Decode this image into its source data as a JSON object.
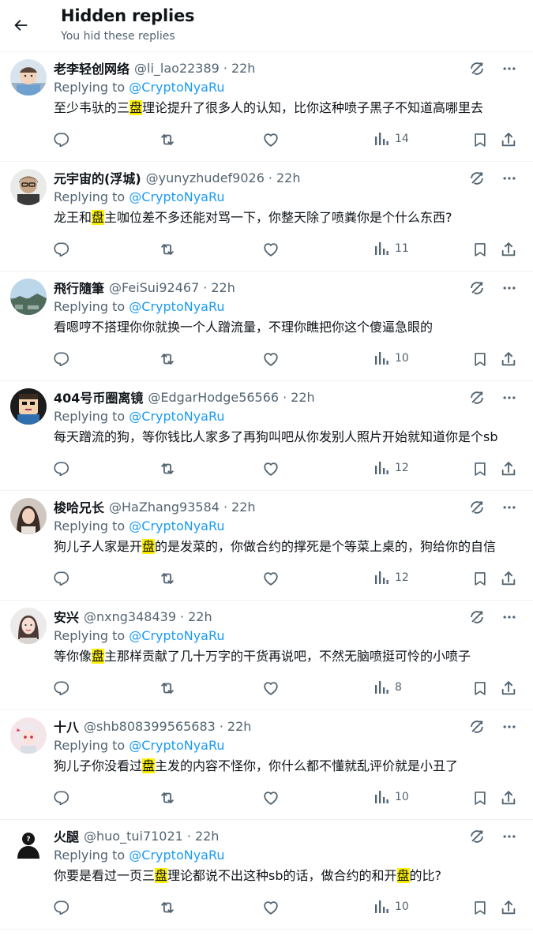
{
  "header": {
    "title": "Hidden replies",
    "subtitle": "You hid these replies"
  },
  "replying_prefix": "Replying to",
  "replies": [
    {
      "name": "老李轻创网络",
      "handle": "@li_lao22389",
      "time": "22h",
      "replying_to": "@CryptoNyaRu",
      "text_parts": [
        "至少韦驮的三",
        "盘",
        "理论提升了很多人的认知，比你这种喷子黑子不知道高哪里去"
      ],
      "views": "14",
      "avatar": "baby-photo-avatar"
    },
    {
      "name": "元宇宙的(浮城)",
      "handle": "@yunyzhudef9026",
      "time": "22h",
      "replying_to": "@CryptoNyaRu",
      "text_parts": [
        "龙王和",
        "盘",
        "主咖位差不多还能对骂一下，你整天除了喷粪你是个什么东西?"
      ],
      "views": "11",
      "avatar": "man-photo-avatar"
    },
    {
      "name": "飛行隨筆",
      "handle": "@FeiSui92467",
      "time": "22h",
      "replying_to": "@CryptoNyaRu",
      "text_parts": [
        "看嗯哼不搭理你你就换一个人蹭流量，不理你瞧把你这个傻逼急眼的",
        "",
        ""
      ],
      "views": "10",
      "avatar": "landscape-avatar"
    },
    {
      "name": "404号币圈离镜",
      "handle": "@EdgarHodge56566",
      "time": "22h",
      "replying_to": "@CryptoNyaRu",
      "text_parts": [
        "每天蹭流的狗，等你钱比人家多了再狗叫吧从你发别人照片开始就知道你是个sb",
        "",
        ""
      ],
      "views": "12",
      "avatar": "cartoon-avatar"
    },
    {
      "name": "梭哈兄长",
      "handle": "@HaZhang93584",
      "time": "22h",
      "replying_to": "@CryptoNyaRu",
      "text_parts": [
        "狗儿子人家是开",
        "盘",
        "的是发菜的，你做合约的撑死是个等菜上桌的，狗给你的自信"
      ],
      "views": "12",
      "avatar": "woman-photo-avatar"
    },
    {
      "name": "安兴",
      "handle": "@nxng348439",
      "time": "22h",
      "replying_to": "@CryptoNyaRu",
      "text_parts": [
        "等你像",
        "盘",
        "主那样贡献了几十万字的干货再说吧，不然无脑喷挺可怜的小喷子"
      ],
      "views": "8",
      "avatar": "woman-portrait-avatar"
    },
    {
      "name": "十八",
      "handle": "@shb808399565683",
      "time": "22h",
      "replying_to": "@CryptoNyaRu",
      "text_parts": [
        "狗儿子你没看过",
        "盘",
        "主发的内容不怪你，你什么都不懂就乱评价就是小丑了"
      ],
      "views": "10",
      "avatar": "anime-avatar"
    },
    {
      "name": "火腿",
      "handle": "@huo_tui71021",
      "time": "22h",
      "replying_to": "@CryptoNyaRu",
      "text_parts": [
        "你要是看过一页三",
        "盘",
        "理论都说不出这种sb的话，做合约的和开",
        "盘",
        "的比?"
      ],
      "views": "10",
      "avatar": "mystery-person-avatar",
      "avatar_label": "神秘人"
    }
  ],
  "colors": {
    "link": "#1d9bf0",
    "secondary_text": "#536471",
    "highlight": "#fff000",
    "divider": "#eff3f4"
  },
  "icons": {
    "back": "arrow-left-icon",
    "hide": "unhide-reply-icon",
    "more": "more-icon",
    "reply": "reply-icon",
    "retweet": "retweet-icon",
    "like": "heart-icon",
    "views": "views-icon",
    "bookmark": "bookmark-icon",
    "share": "share-icon"
  }
}
